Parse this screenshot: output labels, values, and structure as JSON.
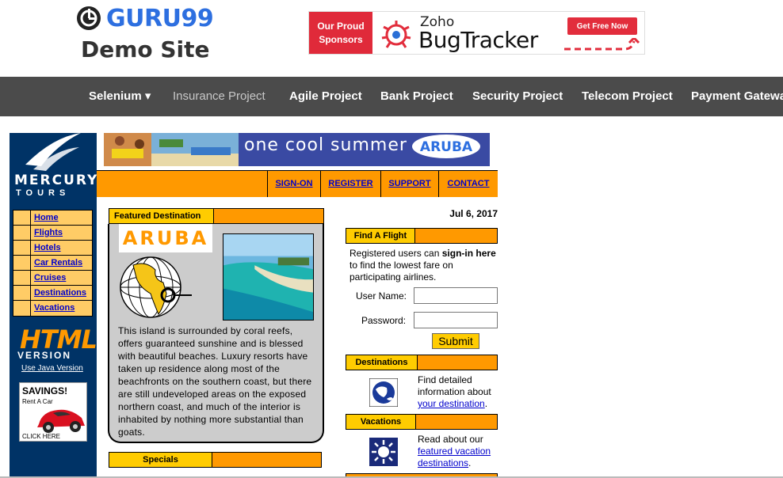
{
  "header": {
    "brand": "GURU99",
    "subtitle": "Demo Site"
  },
  "sponsor": {
    "line1": "Our Proud",
    "line2": "Sponsors",
    "zoho": "Zoho",
    "product": "BugTracker",
    "cta": "Get Free Now"
  },
  "nav": {
    "items": [
      "Selenium ▾",
      "Insurance Project",
      "Agile Project",
      "Bank Project",
      "Security Project",
      "Telecom Project",
      "Payment Gatewa"
    ]
  },
  "mercury": {
    "name1": "MERCURY",
    "name2": "TOURS",
    "sidebar": [
      "Home",
      "Flights",
      "Hotels",
      "Car Rentals",
      "Cruises",
      "Destinations",
      "Vacations"
    ],
    "html_badge": "HTML",
    "version": "VERSION",
    "java_link": "Use Java Version",
    "savings": "SAVINGS!",
    "rent": "Rent A Car",
    "click": "CLICK HERE"
  },
  "banner": {
    "text": "one cool summer",
    "aruba": "ARUBA"
  },
  "topnav": [
    "SIGN-ON",
    "REGISTER",
    "SUPPORT",
    "CONTACT"
  ],
  "featured": {
    "header": "Featured Destination",
    "title": "ARUBA",
    "text": "This island is surrounded by coral reefs, offers guaranteed sunshine and is blessed with beautiful beaches. Luxury resorts have taken up residence along most of the beachfronts on the southern coast, but there are still undeveloped areas on the exposed northern coast, and much of the interior is inhabited by nothing more substantial than goats."
  },
  "specials": {
    "header": "Specials"
  },
  "date": "Jul 6, 2017",
  "find_flight": {
    "header": "Find A Flight",
    "text_pre": "Registered users can ",
    "text_bold": "sign-in here",
    "text_post": " to find the lowest fare on participating airlines.",
    "username_label": "User Name:",
    "password_label": "Password:",
    "submit": "Submit"
  },
  "destinations": {
    "header": "Destinations",
    "text": "Find detailed information about ",
    "link": "your destination",
    "end": "."
  },
  "vacations": {
    "header": "Vacations",
    "text": "Read about our ",
    "link": "featured vacation destinations",
    "end": "."
  },
  "colors": {
    "brand_blue": "#2d6fe0",
    "nav_bg": "#4b4b4b",
    "mercury_navy": "#003366",
    "orange": "#ff9900",
    "yellow": "#ffcc00"
  }
}
